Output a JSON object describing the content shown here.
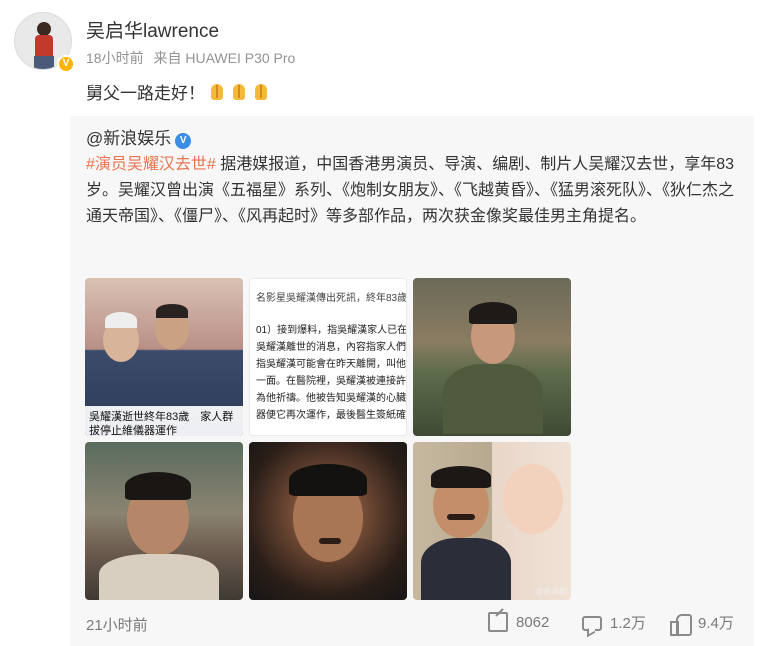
{
  "post": {
    "author": "吴启华lawrence",
    "time": "18小时前",
    "source": "来自 HUAWEI P30 Pro",
    "text": "舅父一路走好！",
    "emoji_count": 3,
    "emoji_icon": "praying-hands-icon"
  },
  "repost": {
    "author": "@新浪娱乐",
    "hashtag": "#演员吴耀汉去世#",
    "body": " 据港媒报道，中国香港男演员、导演、编剧、制片人吴耀汉去世，享年83岁。吴耀汉曾出演《五福星》系列、《炮制女朋友》、《飞越黄昏》、《猛男滚死队》、《狄仁杰之通天帝国》、《僵尸》、《风再起时》等多部作品，两次获金像奖最佳男主角提名。",
    "images": {
      "img1_caption_1": "吳耀漢逝世終年83歲　家人群",
      "img1_caption_2": "拔停止維儀器運作",
      "img2_lines": [
        "名影星吳耀漢傳出死訊，終年83歲。",
        "01）接到爆料，指吳耀漢家人已在通",
        "吳耀漢離世的消息，內容指家人們接",
        "指吳耀漢可能會在昨天離開，叫他們",
        "一面。在醫院裡，吳耀漢被連接許多",
        "為他祈禱。他被告知吳耀漢的心臟李",
        "器便它再次運作，最後醫生簽紙確認"
      ],
      "watermark": "@新浪娱"
    },
    "footer": {
      "time": "21小时前",
      "share_count": "8062",
      "comment_count": "1.2万",
      "like_count": "9.4万"
    }
  },
  "colors": {
    "hashtag": "#eb7350",
    "meta_gray": "#939393",
    "verified_gold": "#ffb400",
    "verified_blue": "#3a8ee6"
  }
}
